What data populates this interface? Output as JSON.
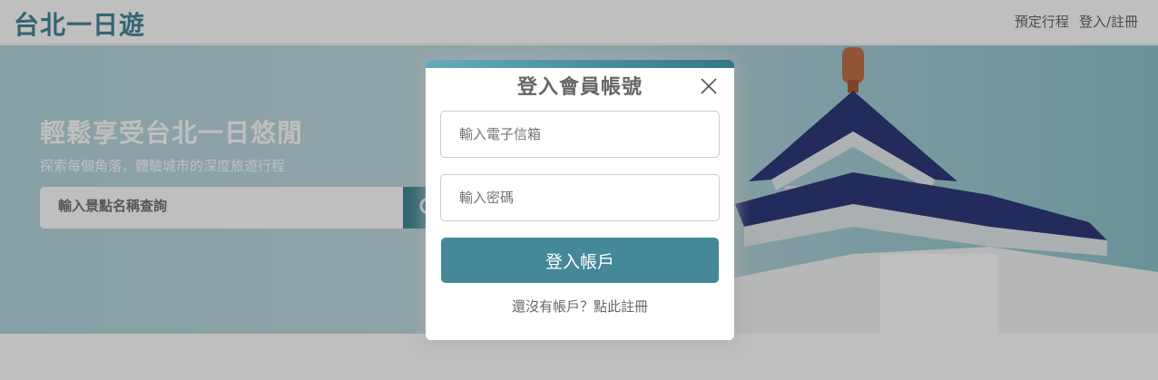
{
  "app": {
    "title": "台北一日遊"
  },
  "nav": {
    "schedule_label": "預定行程",
    "auth_label": "登入/註冊"
  },
  "hero": {
    "slogan": "輕鬆享受台北一日悠閒",
    "subtitle": "探索每個角落，體驗城市的深度旅遊行程",
    "search_placeholder": "輸入景點名稱查詢"
  },
  "modal": {
    "title": "登入會員帳號",
    "email_placeholder": "輸入電子信箱",
    "password_placeholder": "輸入密碼",
    "submit_label": "登入帳戶",
    "register_prompt": "還沒有帳戶？點此註冊"
  },
  "colors": {
    "accent": "#448899",
    "text": "#666666"
  },
  "icons": {
    "close": "close-icon",
    "search": "search-icon"
  }
}
